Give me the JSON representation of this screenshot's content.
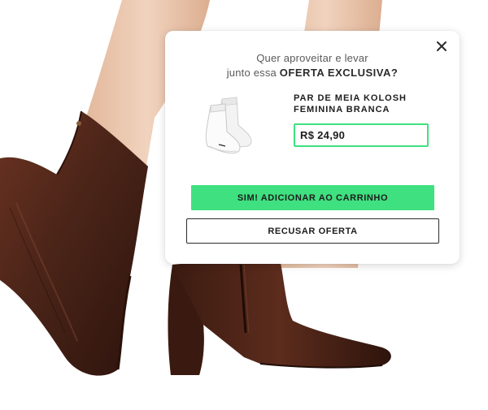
{
  "background": {
    "image": "boot-model-photo",
    "colors": {
      "boot": "#4a2418",
      "skin": "#e9c7ad"
    }
  },
  "popup": {
    "close_icon": "close-icon",
    "headline_line1": "Quer aproveitar e levar",
    "headline_line2_prefix": "junto essa ",
    "headline_line2_bold": "OFERTA EXCLUSIVA?",
    "product": {
      "image": "sock-product-image",
      "name_line1": "PAR DE MEIA KOLOSH",
      "name_line2": "FEMININA BRANCA",
      "price": "R$ 24,90"
    },
    "accept_label": "SIM! ADICIONAR AO CARRINHO",
    "decline_label": "RECUSAR OFERTA"
  },
  "colors": {
    "accent": "#3fe07f",
    "text": "#1d1d1d",
    "muted": "#5a5a5a"
  }
}
